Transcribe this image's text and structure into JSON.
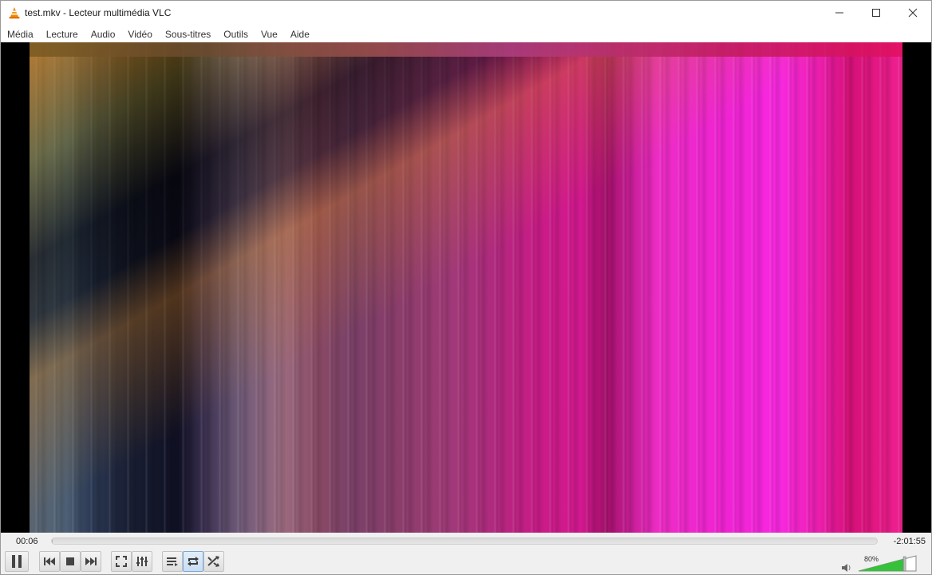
{
  "window": {
    "title": "test.mkv - Lecteur multimédia VLC"
  },
  "menu": {
    "items": [
      "Média",
      "Lecture",
      "Audio",
      "Vidéo",
      "Sous-titres",
      "Outils",
      "Vue",
      "Aide"
    ]
  },
  "playback": {
    "elapsed": "00:06",
    "remaining": "-2:01:55",
    "progress_fraction": 0.0008
  },
  "volume": {
    "label": "80%",
    "level_fraction": 0.8
  },
  "colors": {
    "accent_active": "#7aa6d6",
    "volume_green": "#35c23a",
    "video_background": "#000000"
  },
  "icons": {
    "app": "vlc-cone-icon",
    "minimize": "minimize-icon",
    "maximize": "maximize-icon",
    "close": "close-icon",
    "pause": "pause-icon",
    "previous": "previous-icon",
    "stop": "stop-icon",
    "next": "next-icon",
    "fullscreen": "fullscreen-icon",
    "extended": "equalizer-icon",
    "playlist": "playlist-icon",
    "loop": "loop-icon",
    "random": "shuffle-icon",
    "volume": "speaker-icon"
  }
}
